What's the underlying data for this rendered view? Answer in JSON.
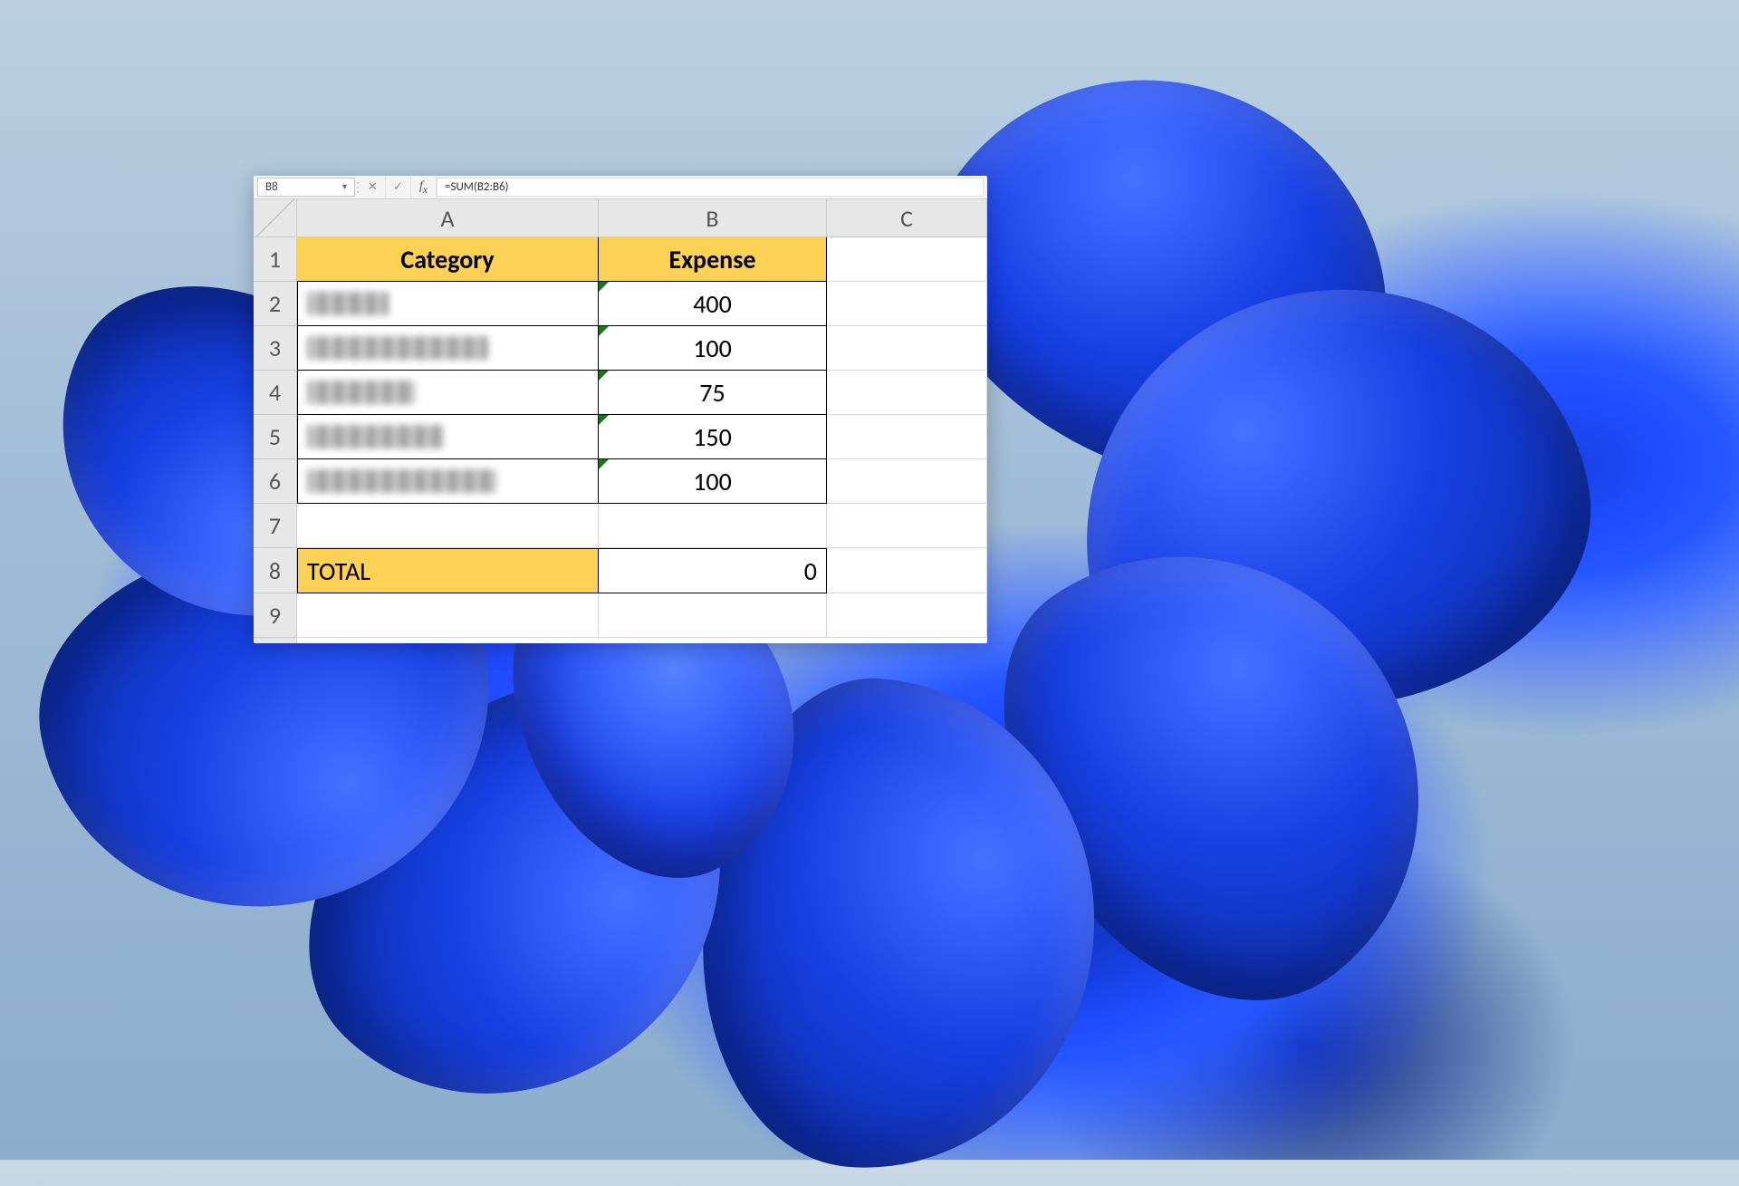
{
  "formula_bar": {
    "cell_reference": "B8",
    "formula": "=SUM(B2:B6)"
  },
  "columns": [
    "A",
    "B",
    "C"
  ],
  "rows": [
    "1",
    "2",
    "3",
    "4",
    "5",
    "6",
    "7",
    "8",
    "9"
  ],
  "headers": {
    "a1": "Category",
    "b1": "Expense"
  },
  "data": {
    "a2_redacted": true,
    "a3_redacted": true,
    "a4_redacted": true,
    "a5_redacted": true,
    "a6_redacted": true,
    "b2": "400",
    "b3": "100",
    "b4": "75",
    "b5": "150",
    "b6": "100"
  },
  "total": {
    "label": "TOTAL",
    "value": "0"
  }
}
